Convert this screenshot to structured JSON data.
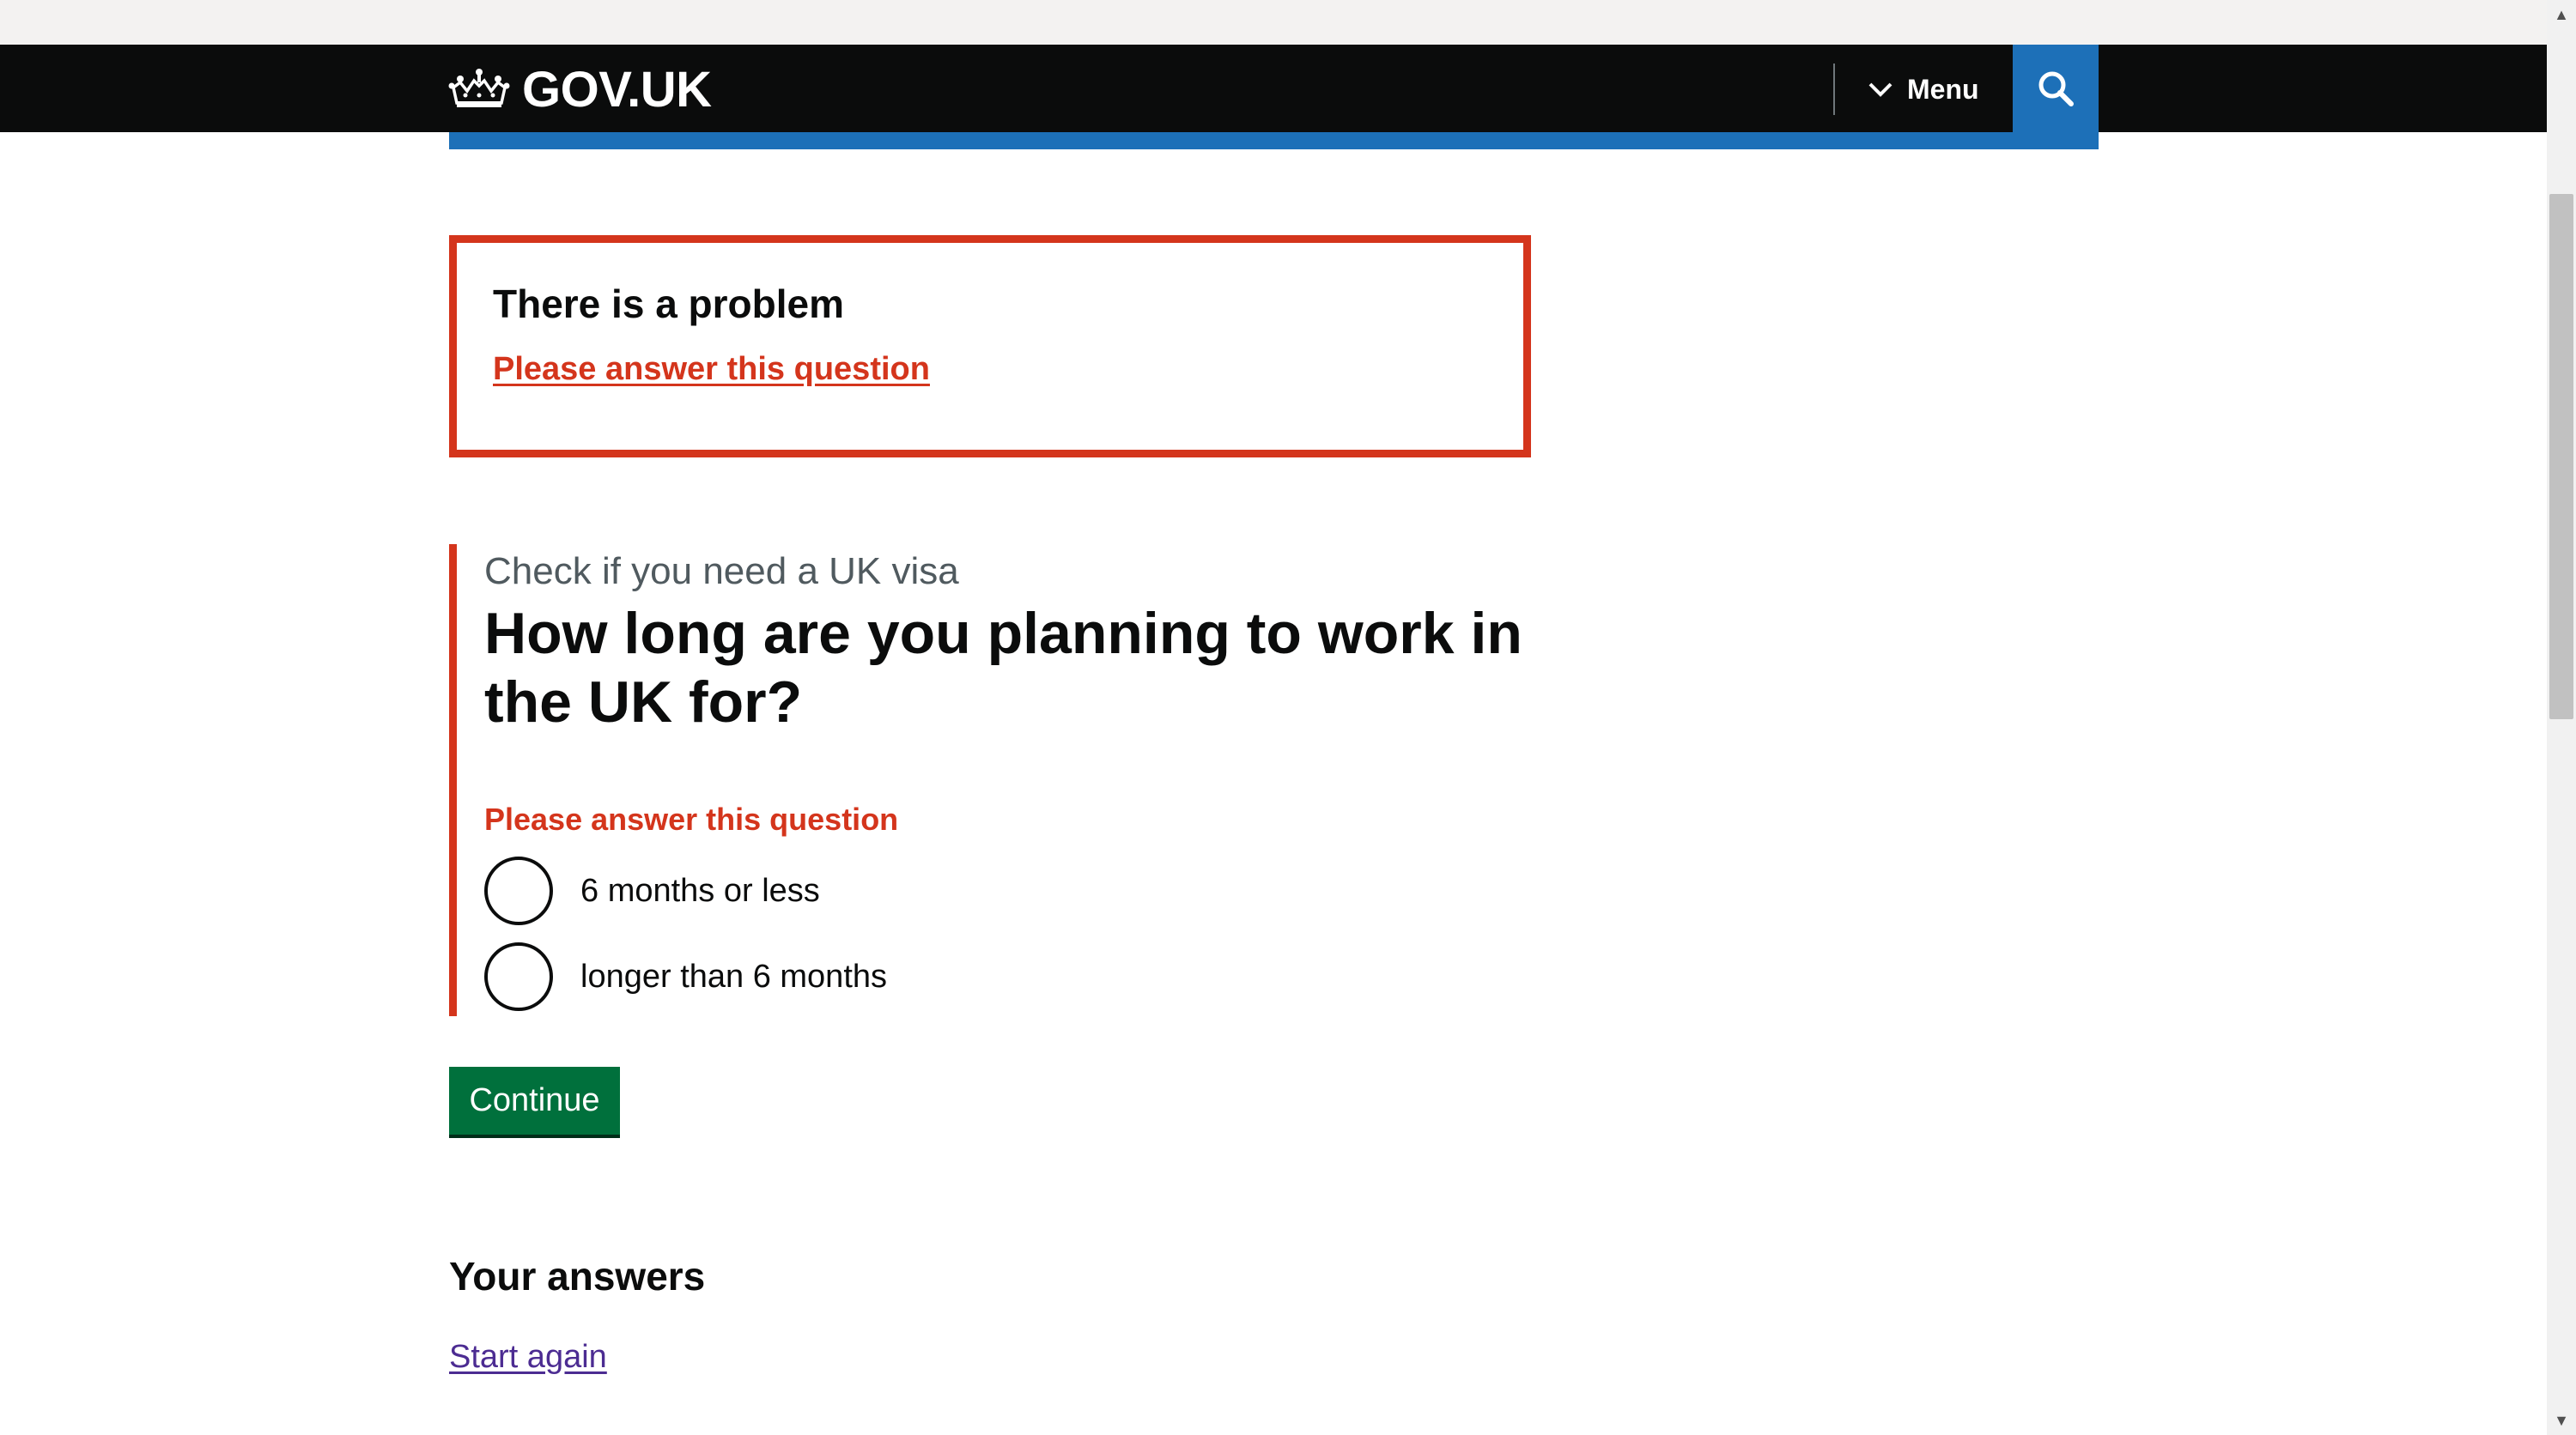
{
  "header": {
    "logo_text": "GOV.UK",
    "menu_label": "Menu",
    "brand_color": "#1d70b8"
  },
  "error_summary": {
    "title": "There is a problem",
    "link": "Please answer this question",
    "color": "#d4351c"
  },
  "question": {
    "caption": "Check if you need a UK visa",
    "heading": "How long are you planning to work in the UK for?",
    "error_message": "Please answer this question",
    "options": [
      {
        "label": "6 months or less",
        "selected": false
      },
      {
        "label": "longer than 6 months",
        "selected": false
      }
    ]
  },
  "actions": {
    "continue_label": "Continue",
    "continue_color": "#00703c"
  },
  "answers": {
    "heading": "Your answers",
    "start_again": "Start again"
  },
  "icons": {
    "logo": "crown-icon",
    "menu": "chevron-down-icon",
    "search": "search-icon"
  }
}
